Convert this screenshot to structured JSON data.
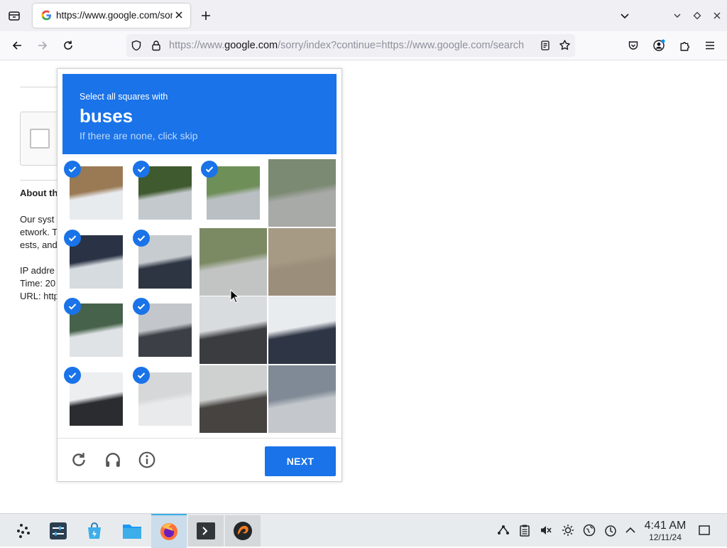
{
  "browser": {
    "tab": {
      "title": "https://www.google.com/sorry/index?continue=https://www.google.com/search"
    },
    "url": {
      "prefix": "https://www.",
      "domain": "google.com",
      "rest": "/sorry/index?continue=https://www.google.com/search"
    }
  },
  "page": {
    "about_heading": "About th",
    "body_lines": [
      "Our syst",
      "etwork. T",
      "ests, and"
    ],
    "ip_line": "IP addre",
    "time_line": "Time: 20",
    "url_line": "URL: http"
  },
  "captcha": {
    "instruction": "Select all squares with",
    "target": "buses",
    "hint": "If there are none, click skip",
    "next_label": "NEXT",
    "tiles": [
      {
        "selected": true,
        "colors": [
          "#9a7a55",
          "#e8ebee"
        ]
      },
      {
        "selected": true,
        "colors": [
          "#3f5a2e",
          "#c4c9cd"
        ]
      },
      {
        "selected": true,
        "colors": [
          "#6f8f59",
          "#b9bfc2"
        ]
      },
      {
        "selected": false,
        "colors": [
          "#7b8a72",
          "#a8aaa8"
        ]
      },
      {
        "selected": true,
        "colors": [
          "#2a3345",
          "#d6dbe0"
        ]
      },
      {
        "selected": true,
        "colors": [
          "#c7ccd0",
          "#2d3442"
        ]
      },
      {
        "selected": false,
        "colors": [
          "#7c8a64",
          "#c1c4c2"
        ]
      },
      {
        "selected": false,
        "colors": [
          "#a69a85",
          "#9b8f7b"
        ]
      },
      {
        "selected": true,
        "colors": [
          "#46624a",
          "#dfe3e6"
        ]
      },
      {
        "selected": true,
        "colors": [
          "#c3c7cb",
          "#3c3f45"
        ]
      },
      {
        "selected": false,
        "colors": [
          "#d9dcde",
          "#3a3c40"
        ]
      },
      {
        "selected": false,
        "colors": [
          "#e9ecef",
          "#2e3544"
        ]
      },
      {
        "selected": true,
        "colors": [
          "#eceef0",
          "#2a2c30"
        ]
      },
      {
        "selected": true,
        "colors": [
          "#d5d7d8",
          "#e9eaeb"
        ]
      },
      {
        "selected": false,
        "colors": [
          "#cfd1d0",
          "#464340"
        ]
      },
      {
        "selected": false,
        "colors": [
          "#7f8a96",
          "#c4c8cc"
        ]
      }
    ],
    "accent_color": "#1a73e8"
  },
  "taskbar": {
    "clock_time": "4:41 AM",
    "clock_date": "12/11/24"
  }
}
